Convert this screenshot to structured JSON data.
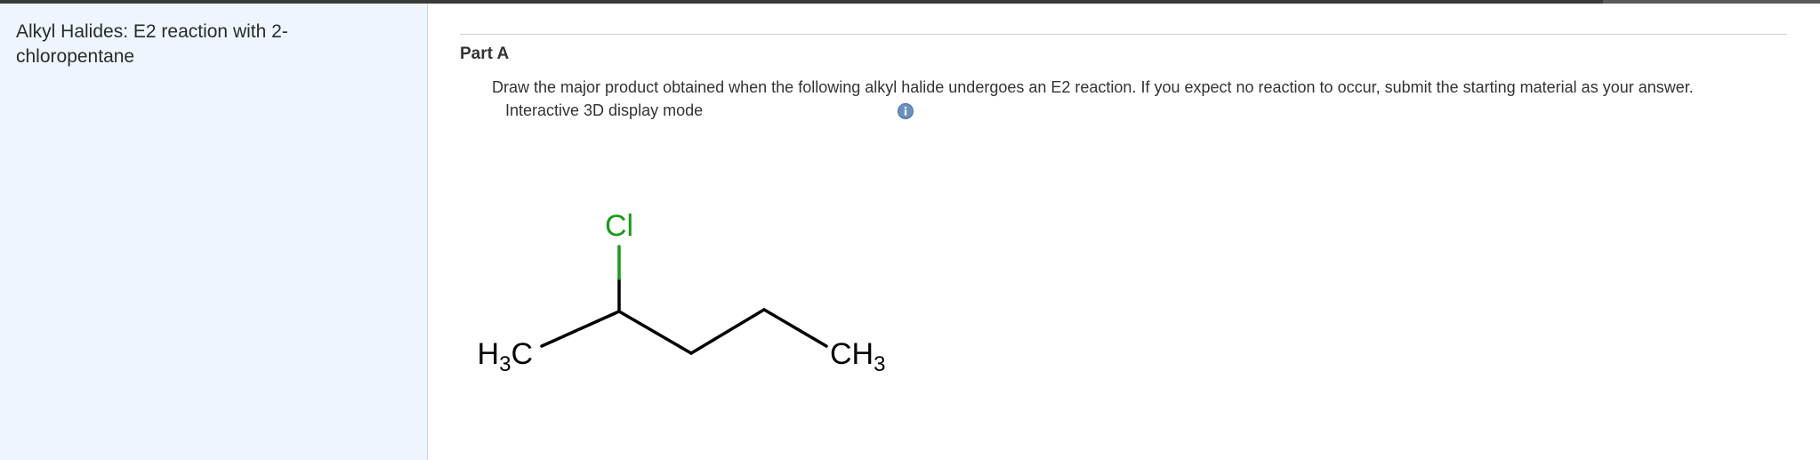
{
  "sidebar": {
    "title": "Alkyl Halides: E2 reaction with 2-chloropentane"
  },
  "main": {
    "part_title": "Part A",
    "instructions": "Draw the major product obtained when the following alkyl halide undergoes an E2 reaction. If you expect no reaction to occur, submit the starting material as your answer.",
    "display_mode_label": "Interactive 3D display mode",
    "info_icon": "info-icon"
  },
  "molecule": {
    "labels": {
      "chlorine": "Cl",
      "left_methyl_h": "H",
      "left_methyl_sub": "3",
      "left_methyl_c": "C",
      "right_methyl_c": "CH",
      "right_methyl_sub": "3"
    },
    "colors": {
      "bond": "#000000",
      "chlorine": "#1a9a1a"
    }
  }
}
